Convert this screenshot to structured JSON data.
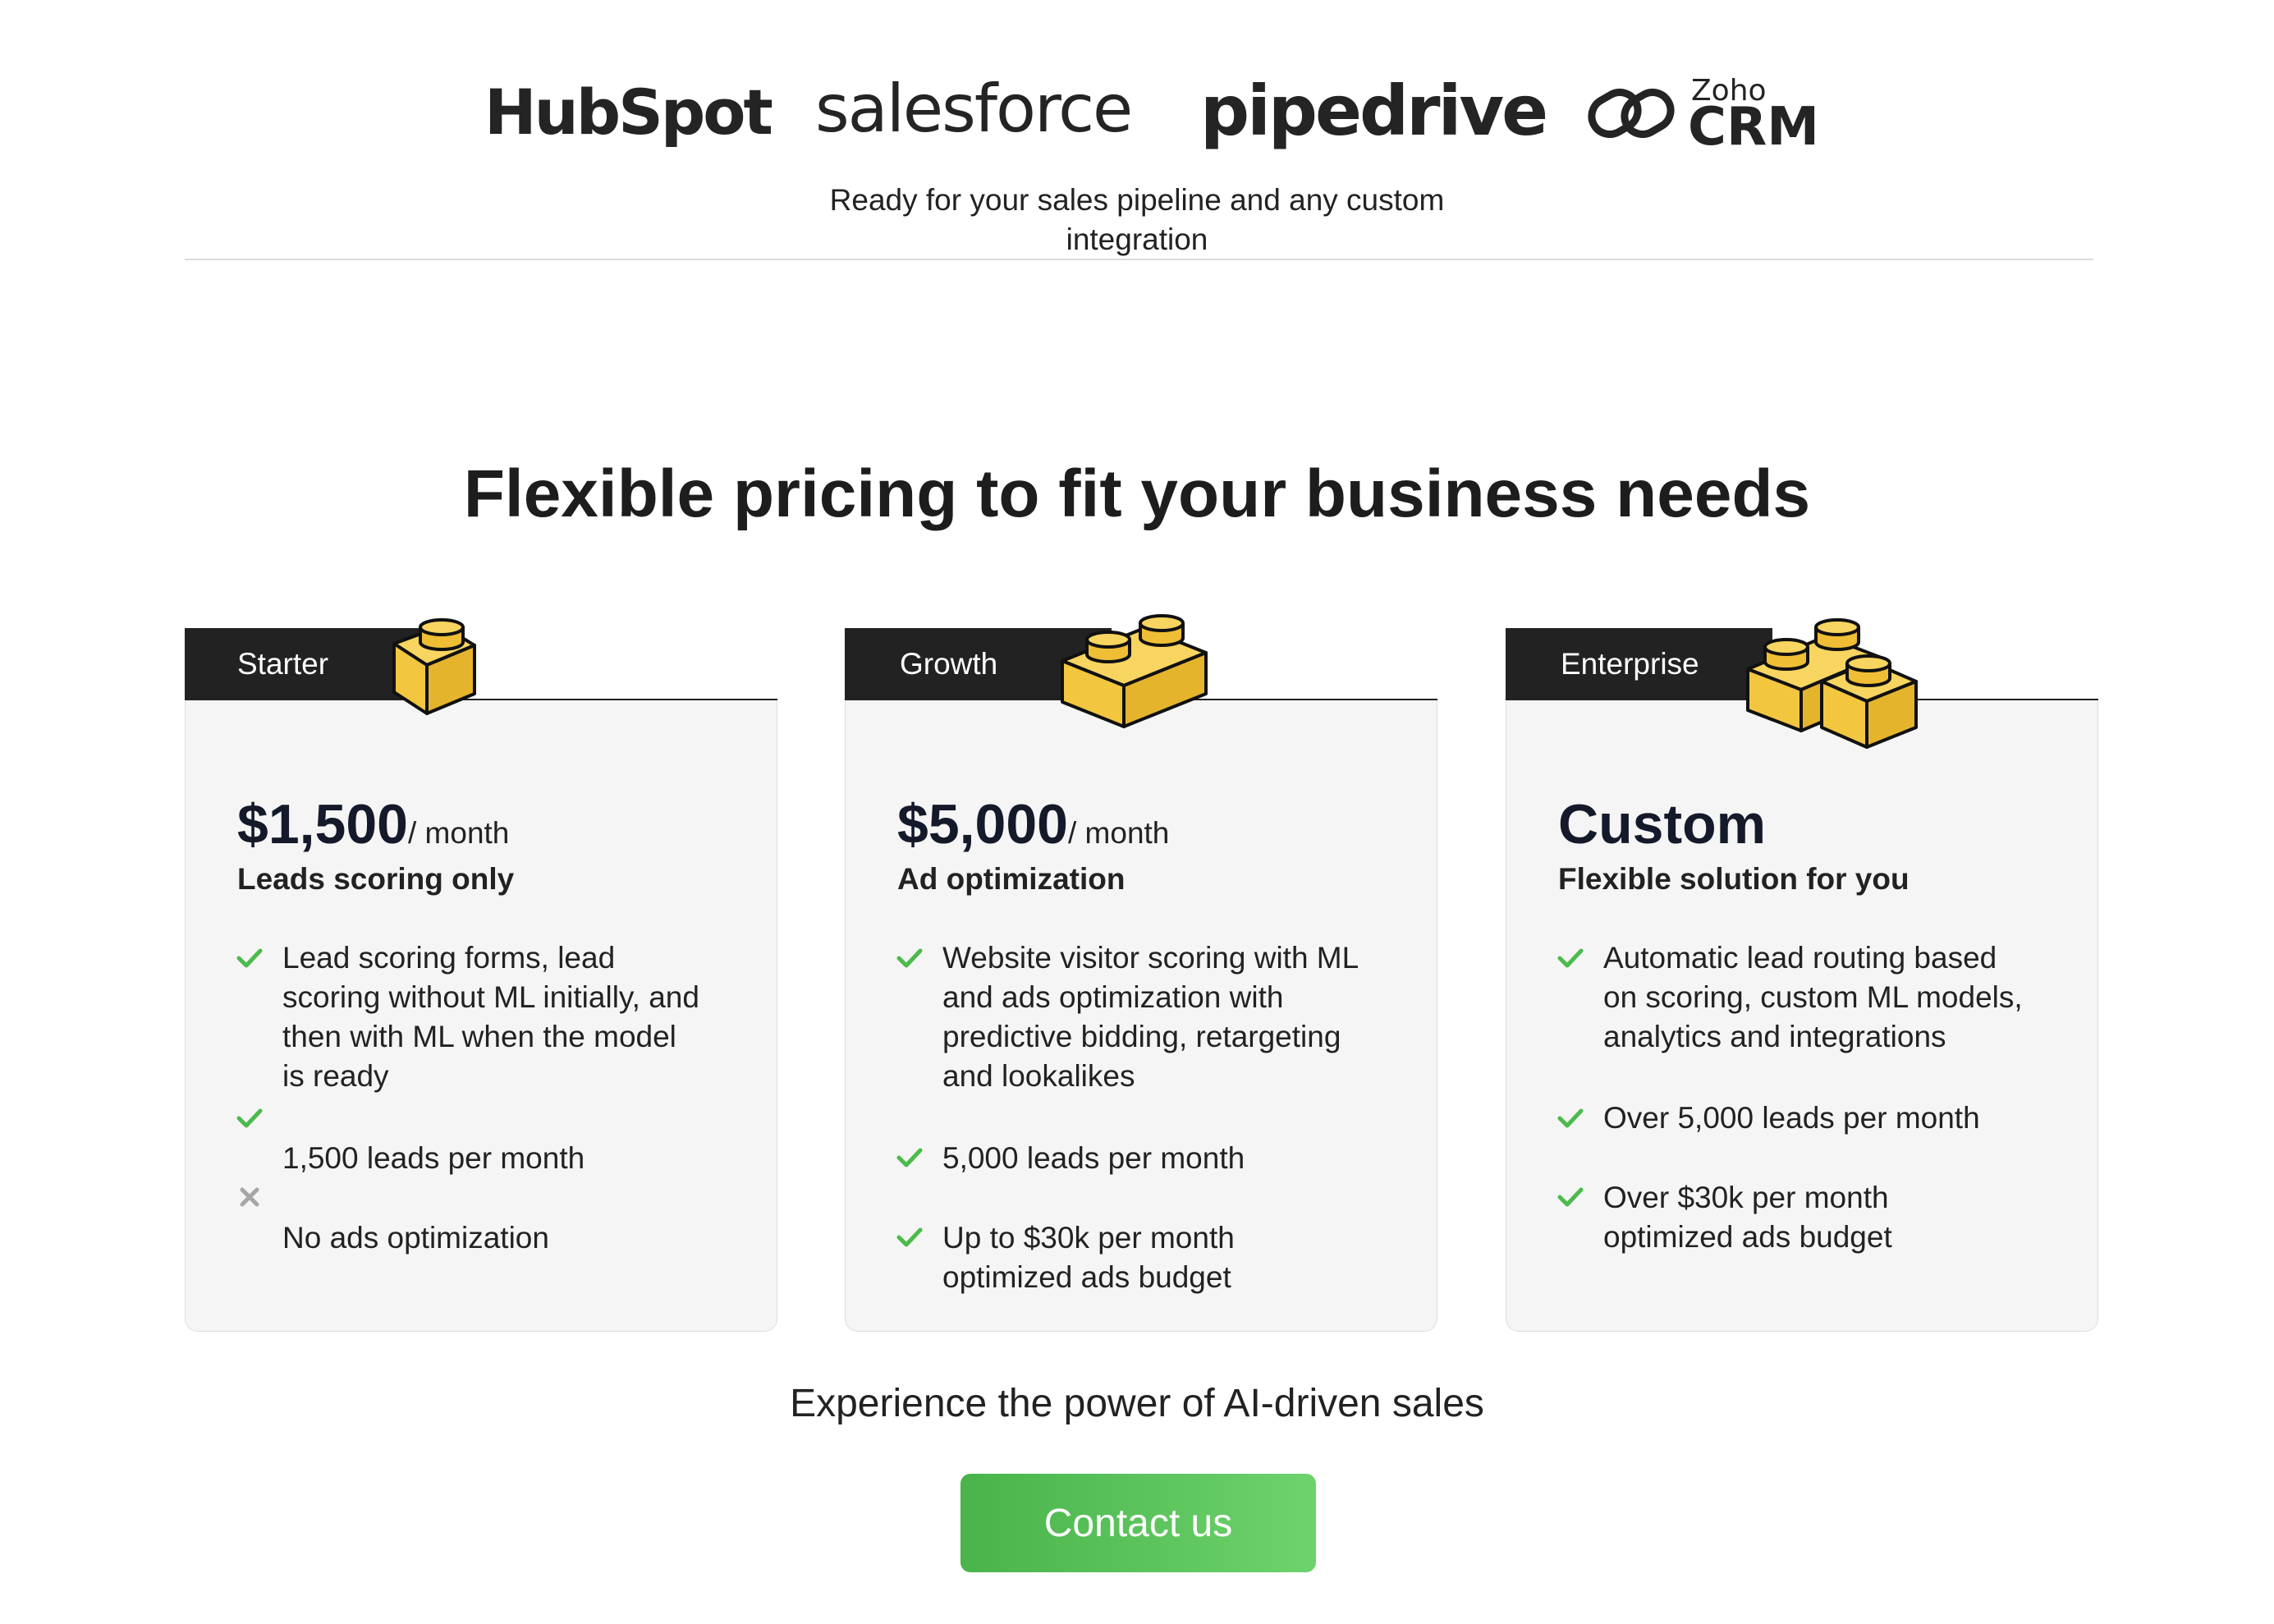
{
  "partners": {
    "logos": [
      "HubSpot",
      "salesforce",
      "pipedrive"
    ],
    "zoho_small": "Zoho",
    "zoho_big": "CRM",
    "tagline_line1": "Ready for your sales pipeline and any custom",
    "tagline_line2": "integration"
  },
  "headline": "Flexible pricing to fit your business needs",
  "plans": [
    {
      "tab": "Starter",
      "price": "$1,500",
      "period": "/ month",
      "subtitle": "Leads scoring only",
      "features": [
        {
          "status": "check",
          "lines": [
            "Lead scoring forms, lead",
            "scoring without ML initially, and",
            "then with ML when the model",
            "is ready"
          ]
        },
        {
          "status": "check",
          "lines": [
            "1,500 leads per month"
          ]
        },
        {
          "status": "cross",
          "lines": [
            "No ads optimization"
          ]
        }
      ]
    },
    {
      "tab": "Growth",
      "price": "$5,000",
      "period": "/ month",
      "subtitle": "Ad optimization",
      "features": [
        {
          "status": "check",
          "lines": [
            "Website visitor scoring with ML",
            "and ads optimization with",
            "predictive bidding, retargeting",
            "and lookalikes"
          ]
        },
        {
          "status": "check",
          "lines": [
            "5,000 leads per month"
          ]
        },
        {
          "status": "check",
          "lines": [
            "Up to $30k per month",
            "optimized ads budget"
          ]
        }
      ]
    },
    {
      "tab": "Enterprise",
      "price": "Custom",
      "period": "",
      "subtitle": "Flexible solution for you",
      "features": [
        {
          "status": "check",
          "lines": [
            "Automatic lead routing based",
            "on scoring, custom ML models,",
            "analytics and integrations"
          ]
        },
        {
          "status": "check",
          "lines": [
            "Over 5,000 leads per month"
          ]
        },
        {
          "status": "check",
          "lines": [
            "Over $30k per month",
            "optimized ads budget"
          ]
        }
      ]
    }
  ],
  "cta": {
    "text": "Experience the power of AI-driven sales",
    "button": "Contact us"
  },
  "colors": {
    "check": "#4cbb4c",
    "cross": "#a6a6a6",
    "brick": "#f3c63f",
    "tab_bg": "#222222",
    "card_bg": "#f5f5f5",
    "button": "#5cc35c"
  },
  "icons": {
    "check": "check-icon",
    "cross": "cross-icon",
    "brick": "lego-brick-icon"
  }
}
